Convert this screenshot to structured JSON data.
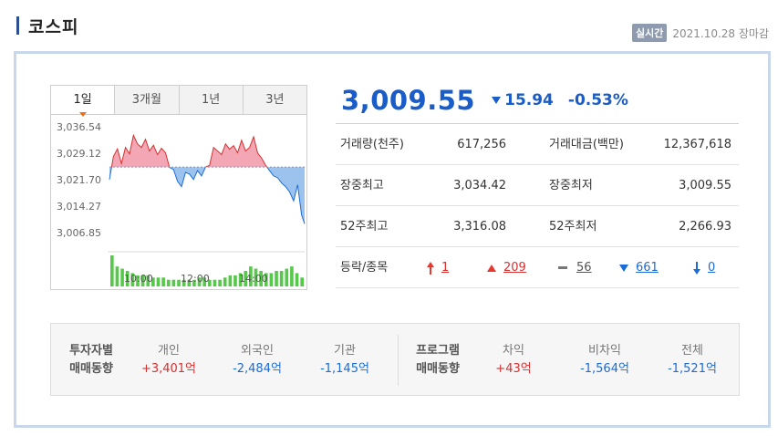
{
  "header": {
    "title": "코스피",
    "badge": "실시간",
    "datetime": "2021.10.28 장마감"
  },
  "tabs": [
    {
      "label": "1일",
      "active": true
    },
    {
      "label": "3개월",
      "active": false
    },
    {
      "label": "1년",
      "active": false
    },
    {
      "label": "3년",
      "active": false
    }
  ],
  "quote": {
    "price": "3,009.55",
    "change": "15.94",
    "rate": "-0.53%",
    "direction": "down"
  },
  "stats": {
    "volume_label": "거래량(천주)",
    "volume_value": "617,256",
    "amount_label": "거래대금(백만)",
    "amount_value": "12,367,618",
    "high_label": "장중최고",
    "high_value": "3,034.42",
    "low_label": "장중최저",
    "low_value": "3,009.55",
    "w52_high_label": "52주최고",
    "w52_high_value": "3,316.08",
    "w52_low_label": "52주최저",
    "w52_low_value": "2,266.93",
    "dist_label": "등락/종목",
    "upper_limit": "1",
    "rise": "209",
    "flat": "56",
    "fall": "661",
    "lower_limit": "0"
  },
  "investor": {
    "head1_line1": "투자자별",
    "head1_line2": "매매동향",
    "cols1": [
      {
        "name": "개인",
        "value": "+3,401억",
        "color": "red"
      },
      {
        "name": "외국인",
        "value": "-2,484억",
        "color": "blue"
      },
      {
        "name": "기관",
        "value": "-1,145억",
        "color": "blue"
      }
    ],
    "head2_line1": "프로그램",
    "head2_line2": "매매동향",
    "cols2": [
      {
        "name": "차익",
        "value": "+43억",
        "color": "red"
      },
      {
        "name": "비차익",
        "value": "-1,564억",
        "color": "blue"
      },
      {
        "name": "전체",
        "value": "-1,521억",
        "color": "blue"
      }
    ]
  },
  "colors": {
    "up": "#d63030",
    "down": "#1a6cd8",
    "price_blue": "#1a5cc8",
    "chart_up_fill": "#f3a6b3",
    "chart_down_fill": "#9cc3ee",
    "volume_bar": "#56c94a",
    "panel_border": "#c8d8ea"
  },
  "chart_data": {
    "type": "line",
    "y_ticks": [
      "3,036.54",
      "3,029.12",
      "3,021.70",
      "3,014.27",
      "3,006.85"
    ],
    "ylim": [
      3006.85,
      3036.54
    ],
    "baseline": 3025.49,
    "x_ticks": [
      "10:00",
      "12:00",
      "14:00"
    ],
    "x_range": [
      540,
      930
    ],
    "series": [
      {
        "x": [
          540,
          548,
          556,
          564,
          572,
          580,
          588,
          596,
          604,
          612,
          620,
          628,
          636,
          644,
          652,
          660,
          668,
          676,
          684,
          692,
          700,
          708,
          716,
          724,
          732,
          740,
          748,
          756,
          764,
          772,
          780,
          788,
          796,
          804,
          812,
          820,
          828,
          836,
          844,
          852,
          860,
          868,
          876,
          884,
          892,
          900,
          908,
          916,
          924,
          930
        ],
        "values": [
          3022.0,
          3028.5,
          3030.6,
          3026.5,
          3031.0,
          3029.2,
          3034.4,
          3032.0,
          3031.0,
          3033.3,
          3030.0,
          3031.6,
          3029.0,
          3030.8,
          3029.5,
          3025.4,
          3024.8,
          3021.5,
          3020.0,
          3024.0,
          3023.5,
          3022.0,
          3024.5,
          3023.0,
          3025.5,
          3026.0,
          3031.0,
          3030.0,
          3029.0,
          3032.0,
          3030.5,
          3031.5,
          3029.5,
          3033.0,
          3030.0,
          3031.0,
          3034.0,
          3029.5,
          3028.0,
          3026.0,
          3024.5,
          3023.0,
          3022.5,
          3021.0,
          3020.0,
          3018.5,
          3016.0,
          3020.5,
          3012.0,
          3009.55
        ]
      }
    ],
    "volume": [
      14,
      9,
      8,
      7,
      6,
      5,
      5,
      5,
      4,
      4,
      4,
      3,
      3,
      3,
      3,
      3,
      3,
      4,
      4,
      3,
      3,
      3,
      4,
      5,
      5,
      6,
      7,
      9,
      8,
      7,
      6,
      6,
      7,
      7,
      8,
      9,
      6,
      4
    ]
  }
}
